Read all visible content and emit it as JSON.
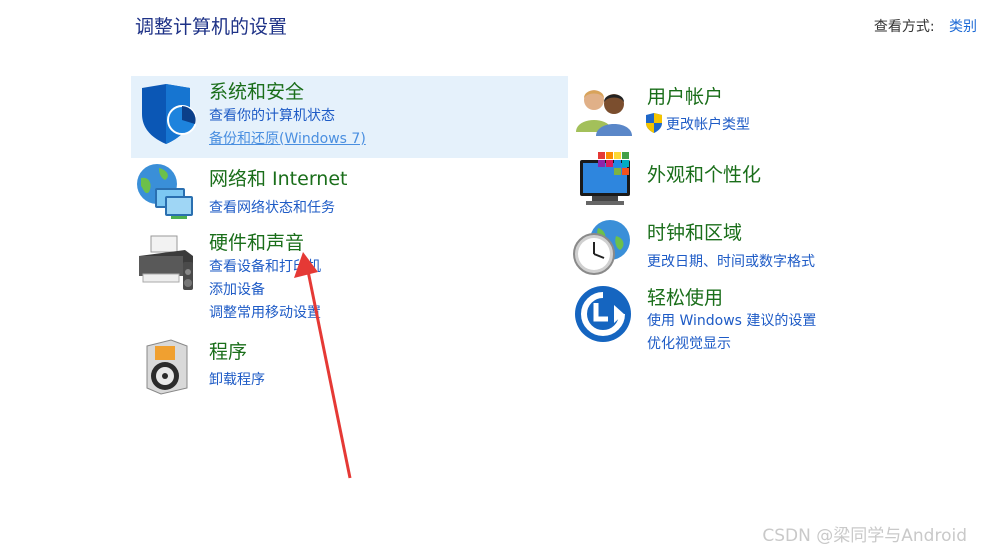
{
  "header": {
    "title": "调整计算机的设置",
    "view_by_label": "查看方式:",
    "view_by_value": "类别"
  },
  "categories": {
    "security": {
      "title": "系统和安全",
      "links": [
        "查看你的计算机状态",
        "备份和还原(Windows 7)"
      ]
    },
    "network": {
      "title": "网络和 Internet",
      "links": [
        "查看网络状态和任务"
      ]
    },
    "hardware": {
      "title": "硬件和声音",
      "links": [
        "查看设备和打印机",
        "添加设备",
        "调整常用移动设置"
      ]
    },
    "programs": {
      "title": "程序",
      "links": [
        "卸载程序"
      ]
    },
    "accounts": {
      "title": "用户帐户",
      "links": [
        "更改帐户类型"
      ]
    },
    "appearance": {
      "title": "外观和个性化",
      "links": []
    },
    "clock": {
      "title": "时钟和区域",
      "links": [
        "更改日期、时间或数字格式"
      ]
    },
    "ease": {
      "title": "轻松使用",
      "links": [
        "使用 Windows 建议的设置",
        "优化视觉显示"
      ]
    }
  },
  "watermark": "CSDN @梁同学与Android",
  "icons": {
    "security": "shield-icon",
    "network": "network-globe-icon",
    "hardware": "printer-icon",
    "programs": "programs-disc-icon",
    "accounts": "users-icon",
    "appearance": "display-palette-icon",
    "clock": "clock-globe-icon",
    "ease": "ease-of-access-icon",
    "uac": "uac-shield-icon"
  },
  "colors": {
    "title_blue": "#1e3287",
    "category_green": "#1a6e1a",
    "link_blue": "#1e5bc6",
    "highlight_bg": "#e5f1fb",
    "arrow_red": "#e53935"
  }
}
